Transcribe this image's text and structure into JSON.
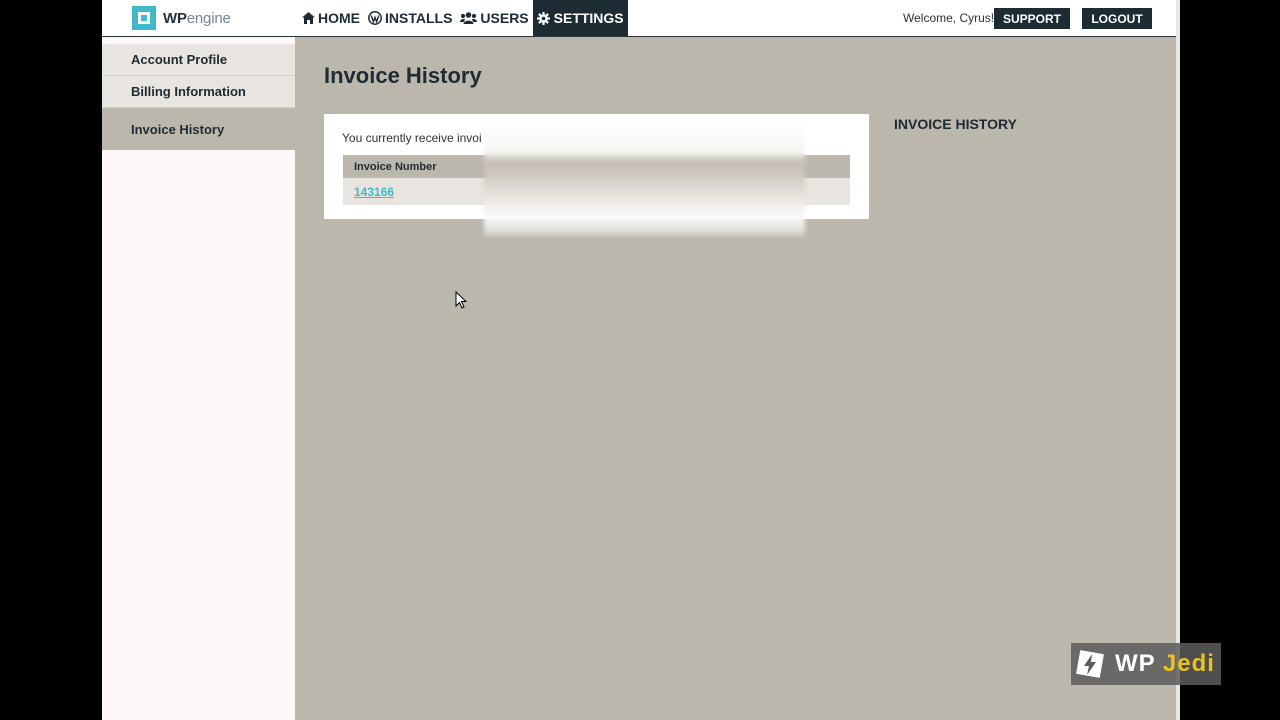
{
  "header": {
    "logo_bold": "WP",
    "logo_light": "engine",
    "nav": [
      {
        "label": "HOME",
        "icon": "home-icon"
      },
      {
        "label": "INSTALLS",
        "icon": "wordpress-icon"
      },
      {
        "label": "USERS",
        "icon": "users-icon"
      },
      {
        "label": "SETTINGS",
        "icon": "gear-icon",
        "active": true
      }
    ],
    "welcome": "Welcome, Cyrus!",
    "support_label": "SUPPORT",
    "logout_label": "LOGOUT"
  },
  "sidebar": {
    "items": [
      {
        "label": "Account Profile"
      },
      {
        "label": "Billing Information"
      },
      {
        "label": "Invoice History",
        "active": true
      }
    ]
  },
  "main": {
    "title": "Invoice History",
    "intro": "You currently receive invoi",
    "table": {
      "columns": [
        "Invoice Number"
      ],
      "rows": [
        {
          "invoice_number": "143166"
        }
      ]
    },
    "side_heading": "INVOICE HISTORY"
  },
  "watermark": {
    "text_main": "WP",
    "text_accent": "Jedi"
  },
  "colors": {
    "accent": "#40bac8",
    "dark": "#1d2b33",
    "background": "#bcb7ad",
    "watermark_accent": "#e9c21b"
  }
}
